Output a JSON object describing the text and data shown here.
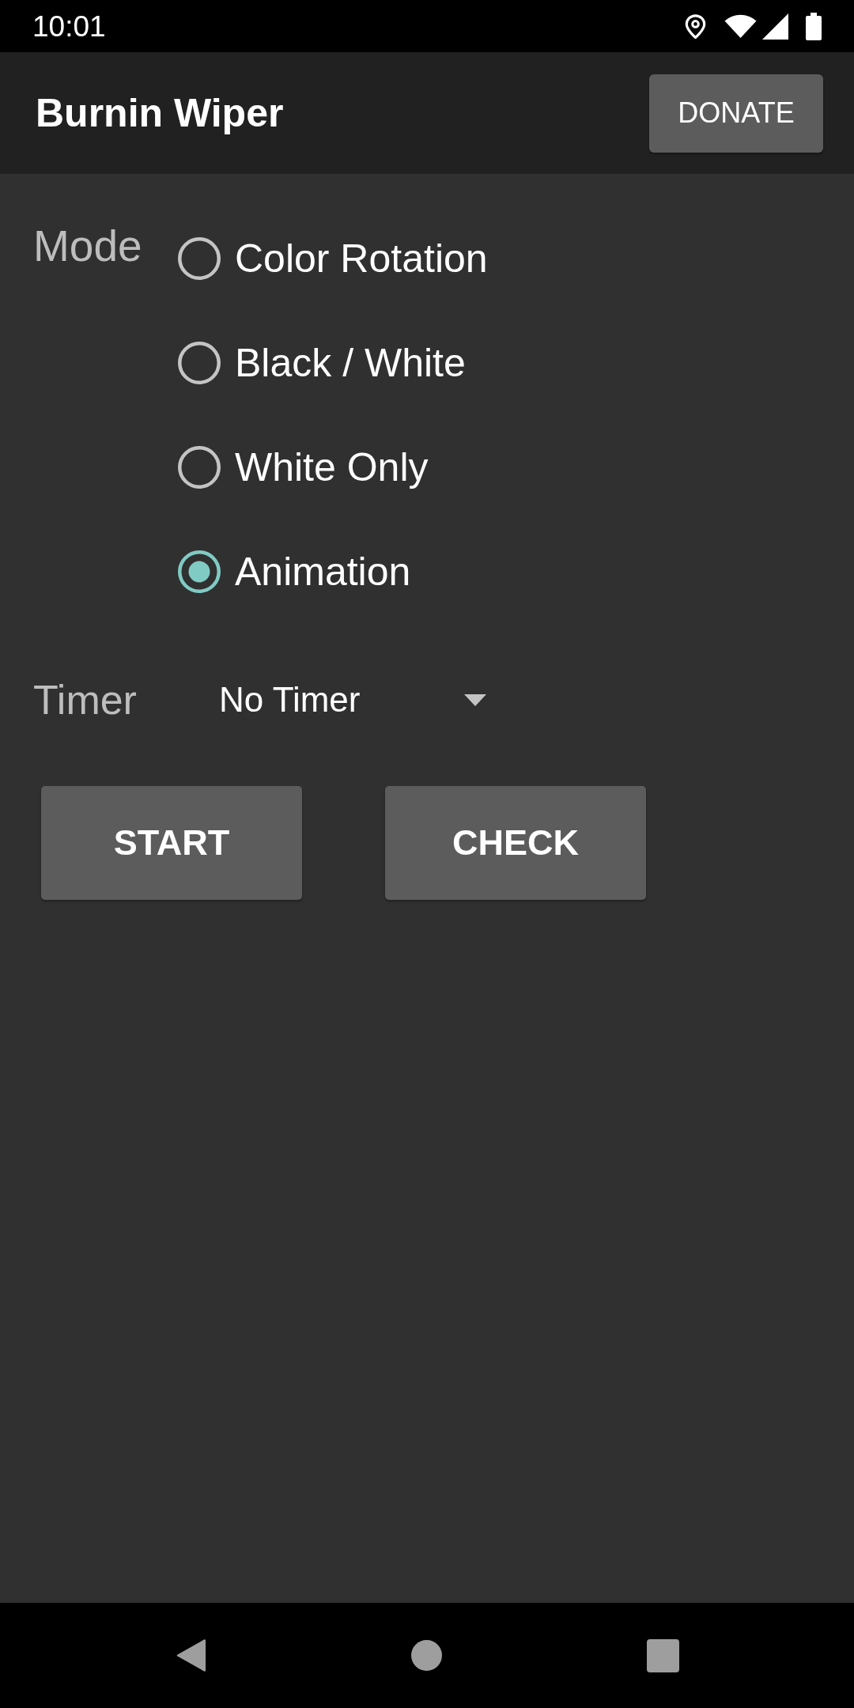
{
  "status_bar": {
    "time": "10:01"
  },
  "app_bar": {
    "title": "Burnin Wiper",
    "action": "DONATE"
  },
  "mode": {
    "label": "Mode",
    "options": [
      {
        "label": "Color Rotation",
        "selected": false
      },
      {
        "label": "Black / White",
        "selected": false
      },
      {
        "label": "White Only",
        "selected": false
      },
      {
        "label": "Animation",
        "selected": true
      }
    ]
  },
  "timer": {
    "label": "Timer",
    "value": "No Timer"
  },
  "buttons": [
    "START",
    "CHECK"
  ]
}
